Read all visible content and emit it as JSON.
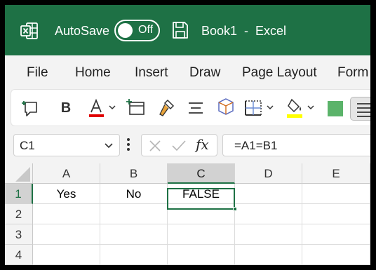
{
  "titlebar": {
    "autosave_label": "AutoSave",
    "autosave_state": "Off",
    "document_title": "Book1  -  Excel",
    "brand_color": "#1e7145",
    "icons": [
      "excel-logo-icon",
      "save-icon"
    ]
  },
  "menu": {
    "tabs": [
      "File",
      "Home",
      "Insert",
      "Draw",
      "Page Layout",
      "Form"
    ]
  },
  "ribbon": {
    "bold_label": "B",
    "icons": [
      "comment-icon",
      "bold-icon",
      "font-color-icon",
      "insert-comment-icon",
      "format-painter-icon",
      "align-center-icon",
      "3d-cube-icon",
      "borders-icon",
      "fill-color-icon",
      "green-swatch-icon",
      "align-left-icon"
    ],
    "font_color": "#e00000",
    "fill_color": "#ffff00",
    "swatch_color": "#5bb36a"
  },
  "formula_bar": {
    "name_box": "C1",
    "fx_label": "fx",
    "formula": "=A1=B1"
  },
  "grid": {
    "columns": [
      "A",
      "B",
      "C",
      "D",
      "E"
    ],
    "rows": [
      "1",
      "2",
      "3",
      "4"
    ],
    "cells": {
      "A1": "Yes",
      "B1": "No",
      "C1": "FALSE"
    },
    "selected_cell": "C1"
  }
}
